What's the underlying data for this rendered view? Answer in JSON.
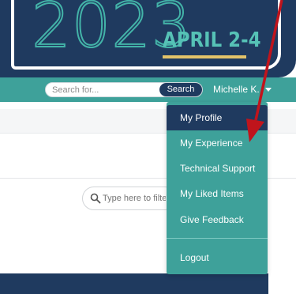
{
  "banner": {
    "year": "2023",
    "dates": "APRIL 2-4"
  },
  "navbar": {
    "search_placeholder": "Search for...",
    "search_button": "Search",
    "user_name": "Michelle K."
  },
  "main": {
    "filter_placeholder": "Type here to filte"
  },
  "user_dropdown": {
    "items": [
      {
        "label": "My Profile"
      },
      {
        "label": "My Experience"
      },
      {
        "label": "Technical Support"
      },
      {
        "label": "My Liked Items"
      },
      {
        "label": "Give Feedback"
      },
      {
        "label": "Logout"
      }
    ],
    "active_index": 0
  },
  "colors": {
    "navy": "#1f3a5f",
    "teal": "#3ea19a",
    "accent_gold": "#e2c36a",
    "annotation_arrow": "#c0141c"
  }
}
